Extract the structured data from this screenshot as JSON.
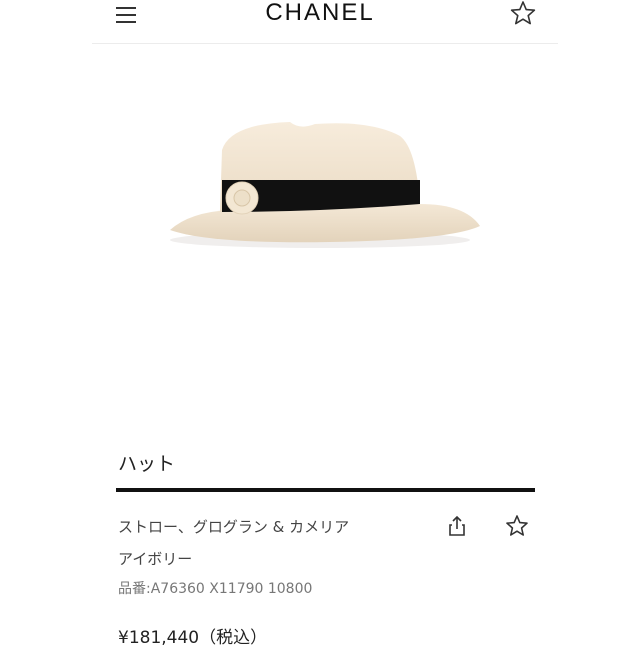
{
  "header": {
    "brand": "CHANEL",
    "menu_icon": "hamburger-menu-icon",
    "wishlist_icon": "star-outline-icon"
  },
  "product": {
    "image_alt_subject": "straw fedora hat with black grosgrain band and camellia",
    "title": "ハット",
    "description": "ストロー、グログラン & カメリア",
    "color": "アイボリー",
    "sku_label": "品番: ",
    "sku_value": "A76360 X11790 10800",
    "price": "¥181,440（税込）",
    "share_icon": "share-icon",
    "favorite_icon": "star-outline-icon"
  },
  "colors": {
    "text": "#222222",
    "muted": "#777777",
    "rule": "#111111"
  }
}
